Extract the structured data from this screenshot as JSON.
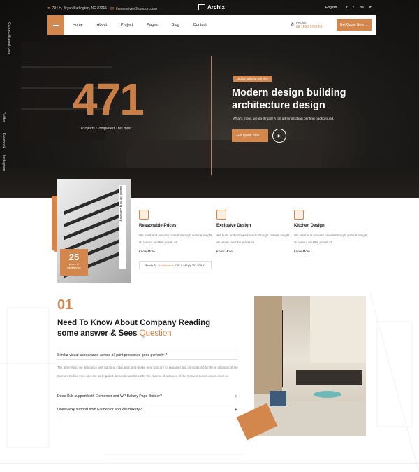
{
  "topbar": {
    "address": "734 H, Bryan Burlington, NC 27215",
    "email": "themesriver@support.com",
    "language": "English",
    "socials": [
      "f",
      "t",
      "Bē",
      "in"
    ]
  },
  "logo": {
    "text": "Archix"
  },
  "nav": {
    "links": [
      "Home",
      "About",
      "Project",
      "Pages",
      "Blog",
      "Contact"
    ],
    "phone_label": "PHONE:",
    "phone_number": "88 1900 6789 56",
    "quote_button": "Get Quote Now"
  },
  "side": {
    "email": "Contact@gmail.com",
    "socials": [
      "Twitter",
      "Facebook",
      "Instagram"
    ]
  },
  "hero": {
    "counter": "471",
    "counter_label": "Projects Completed This Year.",
    "tag": "Digital printing Service",
    "headline_1": "Modern design building",
    "headline_2": "architecture design",
    "subline": "What's more, we do it right! A full administration printing background.",
    "cta": "Get quote now",
    "play_icon": "play-icon"
  },
  "about": {
    "award_text": "Award Winning Company",
    "years": "25",
    "years_label_1": "years of",
    "years_label_2": "experience",
    "features": [
      {
        "icon": "document-icon",
        "title": "Reasonable Prices",
        "desc": "We build and activate brands through cultural insight, str vision, and the power of",
        "more": "Know More"
      },
      {
        "icon": "map-icon",
        "title": "Exclusive Design",
        "desc": "We build and activate brands through cultural insight, str vision, and the power of",
        "more": "Know More"
      },
      {
        "icon": "kitchen-icon",
        "title": "Kitchen Design",
        "desc": "We build and activate brands through cultural insight, str vision, and the power of",
        "more": "Know More"
      }
    ],
    "ready_prefix": "Ready To",
    "ready_link": "Get Started?",
    "ready_call": "CALL +44(0) 203 808 51"
  },
  "faq": {
    "number": "01",
    "title_1": "Need To Know About Company Reading",
    "title_2": "some answer & Sees",
    "title_hl": "Question",
    "questions": [
      {
        "q": "Similar visual appearance across all print processes goes perfectly ?",
        "sign": "−"
      },
      {
        "q": "Does Hub support both Elementor and WP Bakery Page Builder?",
        "sign": "+"
      },
      {
        "q": "Does wexy support both Elementor and WP Bakery?",
        "sign": "+"
      }
    ],
    "answer": "The other hand we denounce with righteou indig ation and dislike men who are so beguiled and demoralized by the of pleasure of the moment Dislike men who are so beguiled demoralic worlds ed by the charms of pleasure of the moment Lorem ipsum dolor sit"
  },
  "colors": {
    "accent": "#d4874c",
    "dark": "#1d1b19"
  }
}
